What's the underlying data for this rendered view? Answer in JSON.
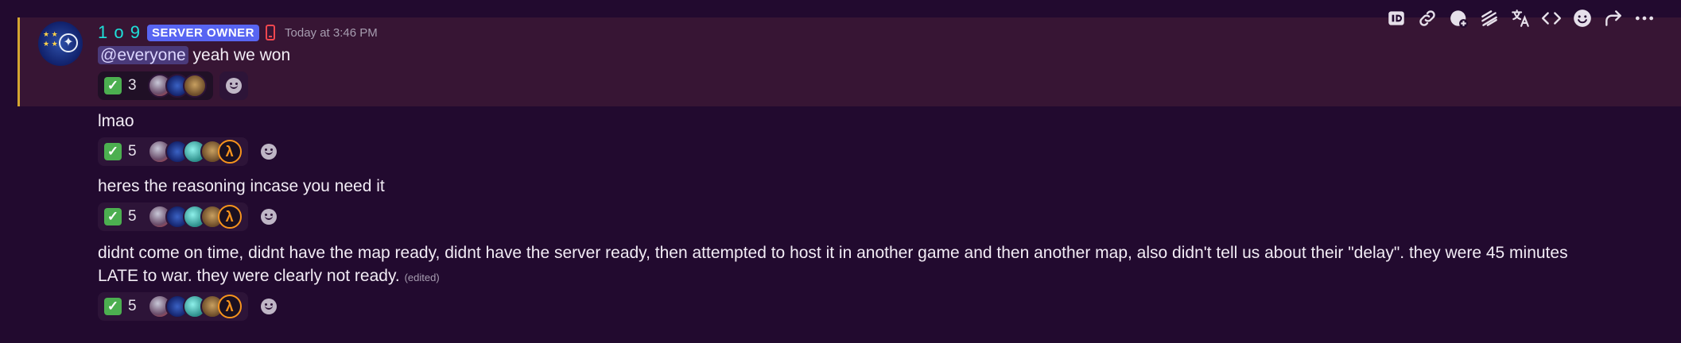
{
  "message": {
    "author": "1 o 9",
    "role_tag": "SERVER OWNER",
    "timestamp": "Today at 3:46 PM",
    "mention": "@everyone",
    "first_text": " yeah we won"
  },
  "followups": [
    {
      "text": "lmao"
    },
    {
      "text": "heres the reasoning incase you need it"
    },
    {
      "line1": "didnt come on time, didnt have the map ready, didnt have the server ready, then attempted to host it in another game and then another map, also didn't tell us about their \"delay\". they were 45 minutes",
      "line2": "LATE to war. they were clearly not ready.",
      "edited": "(edited)"
    }
  ],
  "reactions": [
    {
      "emoji": "check-mark",
      "count": "3"
    },
    {
      "emoji": "check-mark",
      "count": "5"
    },
    {
      "emoji": "check-mark",
      "count": "5"
    },
    {
      "emoji": "check-mark",
      "count": "5"
    }
  ],
  "toolbar_icons": [
    "id-icon",
    "link-icon",
    "thread-icon",
    "mark-unread-icon",
    "translate-icon",
    "code-icon",
    "add-reaction-icon",
    "forward-icon",
    "more-icon"
  ],
  "colors": {
    "username": "#1ee0da",
    "role_tag": "#5865f2",
    "highlight_bar": "#d4a531",
    "background": "#220a2f"
  },
  "half_life_glyph": "λ"
}
